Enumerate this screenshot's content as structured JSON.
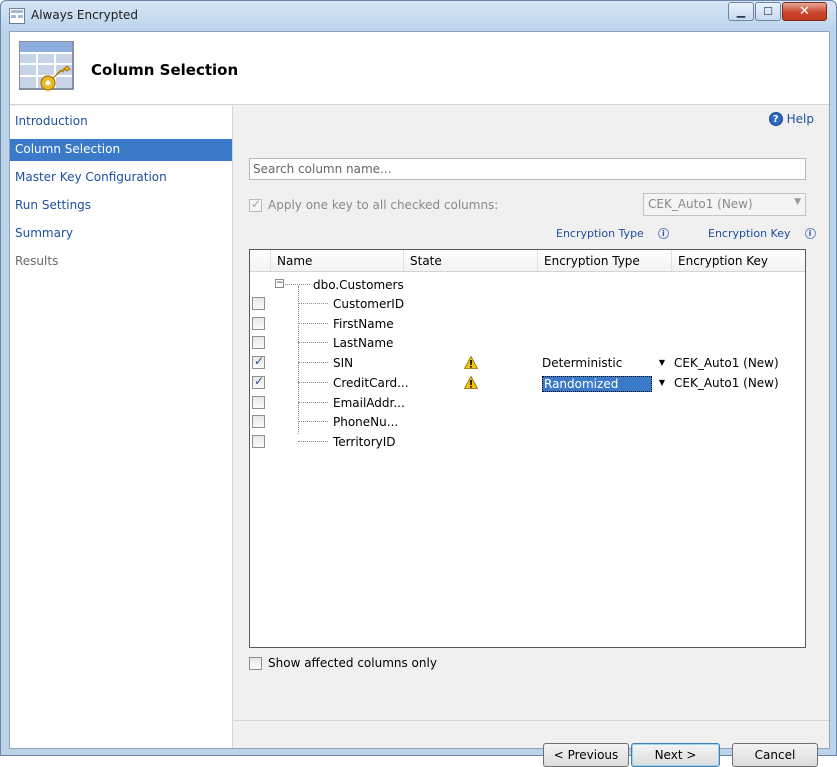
{
  "window": {
    "title": "Always Encrypted"
  },
  "header": {
    "title": "Column Selection"
  },
  "nav": {
    "items": [
      {
        "label": "Introduction",
        "state": "normal"
      },
      {
        "label": "Column Selection",
        "state": "active"
      },
      {
        "label": "Master Key Configuration",
        "state": "normal"
      },
      {
        "label": "Run Settings",
        "state": "normal"
      },
      {
        "label": "Summary",
        "state": "normal"
      },
      {
        "label": "Results",
        "state": "disabled"
      }
    ]
  },
  "main": {
    "help_label": "Help",
    "search_placeholder": "Search column name...",
    "apply_label": "Apply one key to all checked columns:",
    "apply_checked": true,
    "key_select_value": "CEK_Auto1 (New)",
    "encryption_type_hint": "Encryption Type",
    "encryption_key_hint": "Encryption Key",
    "show_affected_label": "Show affected columns only"
  },
  "grid": {
    "columns": [
      "Name",
      "State",
      "Encryption Type",
      "Encryption Key"
    ],
    "table": "dbo.Customers",
    "rows": [
      {
        "name": "CustomerID",
        "checked": false,
        "warning": false,
        "enc_type": "",
        "enc_key": ""
      },
      {
        "name": "FirstName",
        "checked": false,
        "warning": false,
        "enc_type": "",
        "enc_key": ""
      },
      {
        "name": "LastName",
        "checked": false,
        "warning": false,
        "enc_type": "",
        "enc_key": ""
      },
      {
        "name": "SIN",
        "checked": true,
        "warning": true,
        "enc_type": "Deterministic",
        "enc_key": "CEK_Auto1 (New)"
      },
      {
        "name": "CreditCard...",
        "checked": true,
        "warning": true,
        "enc_type": "Randomized",
        "enc_key": "CEK_Auto1 (New)"
      },
      {
        "name": "EmailAddr...",
        "checked": false,
        "warning": false,
        "enc_type": "",
        "enc_key": ""
      },
      {
        "name": "PhoneNu...",
        "checked": false,
        "warning": false,
        "enc_type": "",
        "enc_key": ""
      },
      {
        "name": "TerritoryID",
        "checked": false,
        "warning": false,
        "enc_type": "",
        "enc_key": ""
      }
    ]
  },
  "buttons": {
    "previous": "< Previous",
    "next": "Next >",
    "cancel": "Cancel"
  },
  "colors": {
    "accent": "#3b79c9",
    "link": "#1f4fa0",
    "warning": "#f2c60f"
  }
}
